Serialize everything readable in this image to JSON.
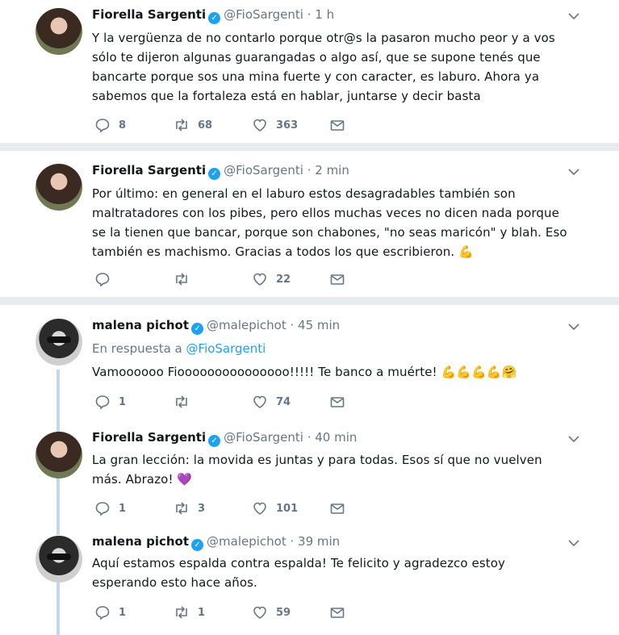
{
  "tweets": [
    {
      "name": "Fiorella Sargenti",
      "handle": "@FioSargenti",
      "time": "· 1 h",
      "text": "Y la vergüenza de no contarlo porque otr@s la pasaron mucho peor y a vos sólo te dijeron algunas guarangadas o algo así, que se supone tenés que bancarte porque sos una mina fuerte y con caracter, es laburo. Ahora ya sabemos que la fortaleza está en hablar, juntarse y decir basta",
      "replies": "8",
      "retweets": "68",
      "likes": "363"
    },
    {
      "name": "Fiorella Sargenti",
      "handle": "@FioSargenti",
      "time": "· 2 min",
      "text": "Por último: en general en el laburo estos desagradables también son maltratadores con los pibes, pero ellos muchas veces no dicen nada porque se la tienen que bancar, porque son chabones, \"no seas maricón\" y blah. Eso también es machismo. Gracias a todos los que escribieron. 💪",
      "replies": "",
      "retweets": "",
      "likes": "22"
    },
    {
      "name": "malena pichot",
      "handle": "@malepichot",
      "time": "· 45 min",
      "reply_label": "En respuesta a",
      "reply_handle": "@FioSargenti",
      "text": "Vamoooooo Fiooooooooooooooo!!!!! Te banco a muérte! 💪💪💪💪🤗",
      "replies": "1",
      "retweets": "",
      "likes": "74"
    },
    {
      "name": "Fiorella Sargenti",
      "handle": "@FioSargenti",
      "time": "· 40 min",
      "text": "La gran lección: la movida es juntas y para todas. Esos sí que no vuelven más. Abrazo! 💜",
      "replies": "1",
      "retweets": "3",
      "likes": "101"
    },
    {
      "name": "malena pichot",
      "handle": "@malepichot",
      "time": "· 39 min",
      "text": "Aquí estamos espalda contra espalda! Te felicito y agradezco estoy esperando esto hace años.",
      "replies": "1",
      "retweets": "1",
      "likes": "59"
    }
  ],
  "icons": {
    "verified": "verified-badge-icon",
    "caret": "chevron-down-icon",
    "reply": "reply-icon",
    "retweet": "retweet-icon",
    "like": "heart-icon",
    "dm": "envelope-icon"
  },
  "colors": {
    "accent": "#1da1f2",
    "muted": "#657786",
    "separator": "#e6ecf0",
    "thread_line": "#c4d8ea"
  }
}
